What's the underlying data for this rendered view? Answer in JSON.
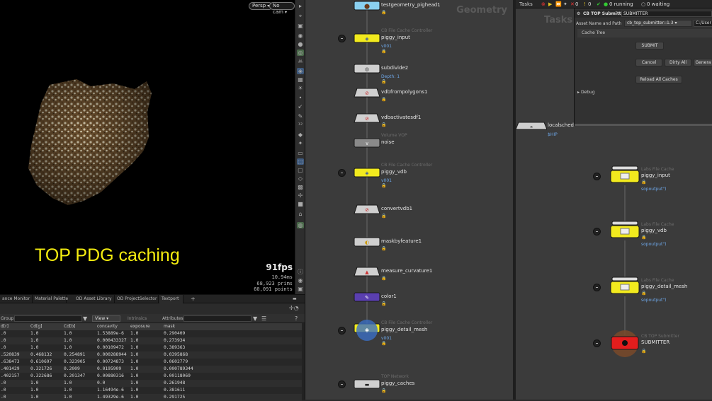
{
  "viewport": {
    "persp_label": "Persp",
    "cam_label": "No cam",
    "overlay_title": "TOP PDG caching",
    "fps": "91fps",
    "frame_time": "10.94ms",
    "prims": "68,923  prims",
    "points": "60,091 points"
  },
  "bottom_tabs": [
    "ance Monitor",
    "Material Palette",
    "OD Asset Library",
    "OD ProjectSelector",
    "Textport",
    "+"
  ],
  "spreadsheet": {
    "group_label": "Group:",
    "view_label": "View",
    "intrinsics_label": "Intrinsics",
    "attributes_label": "Attributes:",
    "columns": [
      "d[r]",
      "Cd[g]",
      "Cd[b]",
      "concavity",
      "exposure",
      "mask"
    ],
    "rows": [
      [
        ".0",
        "1.0",
        "1.0",
        "1.53889e-6",
        "1.0",
        "0.290409"
      ],
      [
        ".0",
        "1.0",
        "1.0",
        "0.000433327",
        "1.0",
        "0.273934"
      ],
      [
        ".0",
        "1.0",
        "1.0",
        "0.00109472",
        "1.0",
        "0.389363"
      ],
      [
        ".520839",
        "0.468132",
        "0.254891",
        "0.000288944",
        "1.0",
        "0.0395868"
      ],
      [
        ".638473",
        "0.610697",
        "0.323905",
        "0.00724873",
        "1.0",
        "0.0602779"
      ],
      [
        ".401429",
        "0.321726",
        "0.2009",
        "0.0195909",
        "1.0",
        "0.000789344"
      ],
      [
        ".402157",
        "0.322686",
        "0.201347",
        "0.00880316",
        "1.0",
        "0.00118069"
      ],
      [
        ".0",
        "1.0",
        "1.0",
        "0.0",
        "1.0",
        "0.261948"
      ],
      [
        ".0",
        "1.0",
        "1.0",
        "1.16494e-6",
        "1.0",
        "0.381611"
      ],
      [
        ".0",
        "1.0",
        "1.0",
        "1.49329e-6",
        "1.0",
        "0.291725"
      ]
    ]
  },
  "geometry": {
    "title": "Geometry",
    "nodes": [
      {
        "name": "testgeometry_pighead1",
        "sub": "",
        "val": ""
      },
      {
        "name": "piggy_input",
        "sub": "CB File Cache Controller",
        "val": "v001"
      },
      {
        "name": "subdivide2",
        "sub": "",
        "val": "Depth: 1"
      },
      {
        "name": "vdbfrompolygons1",
        "sub": "",
        "val": ""
      },
      {
        "name": "vdbactivatesdf1",
        "sub": "",
        "val": ""
      },
      {
        "name": "noise",
        "sub": "Volume VOP",
        "val": ""
      },
      {
        "name": "piggy_vdb",
        "sub": "CB File Cache Controller",
        "val": "v001"
      },
      {
        "name": "convertvdb1",
        "sub": "",
        "val": ""
      },
      {
        "name": "maskbyfeature1",
        "sub": "",
        "val": ""
      },
      {
        "name": "measure_curvature1",
        "sub": "",
        "val": ""
      },
      {
        "name": "color1",
        "sub": "",
        "val": ""
      },
      {
        "name": "piggy_detail_mesh",
        "sub": "CB File Cache Controller",
        "val": "v001"
      },
      {
        "name": "piggy_caches",
        "sub": "TOP Network",
        "val": ""
      }
    ]
  },
  "tasks": {
    "tab_label": "Tasks",
    "title": "Tasks",
    "stat_0a": "0",
    "stat_0b": "0",
    "running": "0 running",
    "waiting": "0 waiting",
    "parm": {
      "node_type": "CB TOP Submitter",
      "node_name": "SUBMITTER",
      "asset_label": "Asset Name and Path",
      "asset_value": "cb_top_submitter::1.3",
      "path_value": "C:/User",
      "cache_tree": "Cache Tree",
      "submit": "SUBMIT",
      "cancel": "Cancel",
      "dirty_all": "Dirty All",
      "generate": "Genera",
      "reload": "Reload All Caches",
      "debug": "Debug"
    },
    "scheduler": {
      "name": "localsched",
      "val": "$HIP"
    },
    "nodes": [
      {
        "name": "piggy_input",
        "sub": "Labs File Cache",
        "val": "sopoutput\")"
      },
      {
        "name": "piggy_vdb",
        "sub": "Labs File Cache",
        "val": "sopoutput\")"
      },
      {
        "name": "piggy_detail_mesh",
        "sub": "Labs File Cache",
        "val": "sopoutput\")"
      },
      {
        "name": "SUBMITTER",
        "sub": "CB TOP Submitter",
        "val": ""
      }
    ]
  },
  "colors": {
    "cache_yellow": "#f2ea1e",
    "submitter_red": "#e31d1d",
    "node_gray": "#cfcfcf",
    "color_purple": "#5a3fb0",
    "link_blue": "#6ea7e8",
    "overlay_yellow": "#f5ed10"
  }
}
